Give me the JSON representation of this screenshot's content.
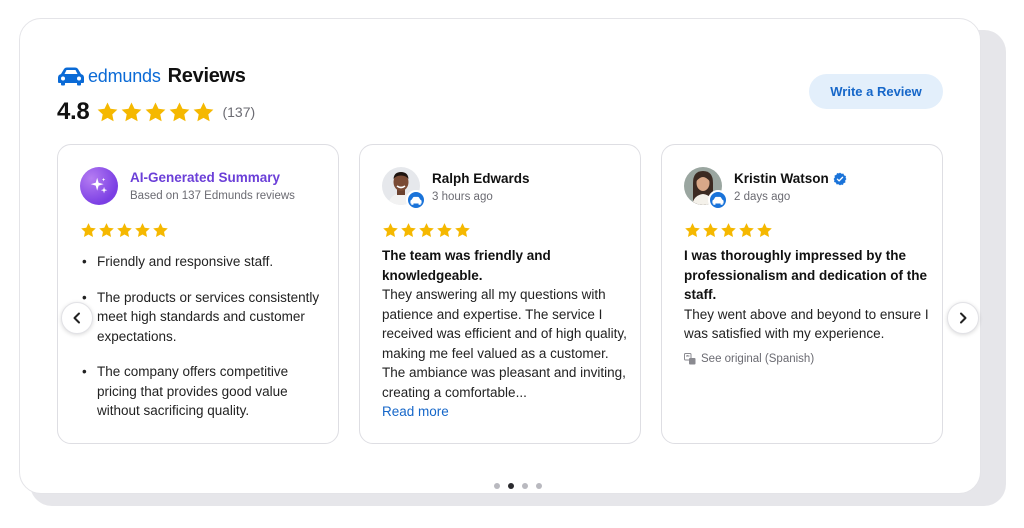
{
  "header": {
    "brand_name": "edmunds",
    "title": "Reviews",
    "rating_value": "4.8",
    "review_count": "(137)",
    "star_rating": 5,
    "write_review_label": "Write a Review"
  },
  "summary_card": {
    "title": "AI-Generated Summary",
    "subtitle": "Based on 137 Edmunds reviews",
    "stars": 5,
    "bullets": [
      "Friendly and responsive staff.",
      "The products or services consistently meet high standards and customer expectations.",
      "The company offers competitive pricing that provides good value without sacrificing quality."
    ]
  },
  "reviews": [
    {
      "name": "Ralph Edwards",
      "time": "3 hours ago",
      "stars": 5,
      "headline": "The team was friendly and knowledgeable.",
      "text": "They answering all my questions with patience and expertise. The service I received was efficient and of high quality, making me feel valued as a customer. The ambiance was pleasant and inviting, creating a comfortable...",
      "read_more": "Read more"
    },
    {
      "name": "Kristin Watson",
      "time": "2 days ago",
      "stars": 5,
      "verified": true,
      "headline": "I was thoroughly impressed by the professionalism and dedication of the staff.",
      "text": "They went above and beyond to ensure I was satisfied with my experience.",
      "see_original": "See original (Spanish)"
    }
  ],
  "pagination": {
    "total": 4,
    "active_index": 1
  },
  "colors": {
    "brand_blue": "#0a6ad6",
    "star_gold": "#f5b800",
    "ai_purple": "#6b3fd8",
    "button_bg": "#e3effb"
  },
  "icons": {
    "logo": "car-icon",
    "ai": "sparkle-icon",
    "badge": "car-badge-icon",
    "verified": "verified-check-icon",
    "translate": "translate-icon",
    "prev": "chevron-left-icon",
    "next": "chevron-right-icon"
  }
}
